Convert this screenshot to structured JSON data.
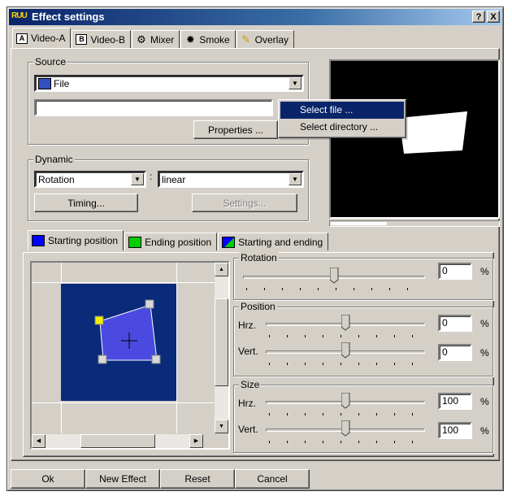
{
  "window": {
    "icon_text": "RUU",
    "title": "Effect settings",
    "help_button": "?",
    "close_button": "X"
  },
  "main_tabs": [
    {
      "label": "Video-A",
      "icon": "A-box-icon",
      "glyph": "A",
      "active": true
    },
    {
      "label": "Video-B",
      "icon": "B-box-icon",
      "glyph": "B",
      "active": false
    },
    {
      "label": "Mixer",
      "icon": "mixer-icon",
      "glyph": "⚙",
      "active": false
    },
    {
      "label": "Smoke",
      "icon": "smoke-icon",
      "glyph": "✹",
      "active": false
    },
    {
      "label": "Overlay",
      "icon": "overlay-icon",
      "glyph": "✎",
      "active": false
    }
  ],
  "source": {
    "group_label": "Source",
    "type_value": "File",
    "path_value": "",
    "properties_button": "Properties ..."
  },
  "context_menu": {
    "items": [
      "Select file ...",
      "Select directory ..."
    ],
    "highlighted_index": 0
  },
  "dynamic": {
    "group_label": "Dynamic",
    "parameter_value": "Rotation",
    "separator": ":",
    "interpolation_value": "linear",
    "timing_button": "Timing...",
    "settings_button": "Settings..."
  },
  "preview": {
    "progress": 0.33
  },
  "position_tabs": [
    {
      "label": "Starting position",
      "icon": "blue-square-icon",
      "color": "#0000ff",
      "active": true
    },
    {
      "label": "Ending position",
      "icon": "green-square-icon",
      "color": "#00cc00",
      "active": false
    },
    {
      "label": "Starting and ending",
      "icon": "blue-green-square-icon",
      "color": "#0000ff",
      "color2": "#00cc00",
      "active": false
    }
  ],
  "canvas_colors": {
    "background": "#0a2a7a",
    "shape_fill": "#4a4ae0",
    "handle_color": "#d8d8d8",
    "handle_active": "#f0f000"
  },
  "rotation": {
    "group_label": "Rotation",
    "value": "0",
    "unit": "%",
    "slider_fraction": 0.5
  },
  "position": {
    "group_label": "Position",
    "hrz_label": "Hrz.",
    "hrz_value": "0",
    "vert_label": "Vert.",
    "vert_value": "0",
    "unit": "%",
    "hrz_fraction": 0.5,
    "vert_fraction": 0.5
  },
  "size": {
    "group_label": "Size",
    "hrz_label": "Hrz.",
    "hrz_value": "100",
    "vert_label": "Vert.",
    "vert_value": "100",
    "unit": "%",
    "hrz_fraction": 0.5,
    "vert_fraction": 0.5
  },
  "footer": {
    "ok_button": "Ok",
    "new_effect_button": "New Effect",
    "reset_button": "Reset",
    "cancel_button": "Cancel"
  }
}
